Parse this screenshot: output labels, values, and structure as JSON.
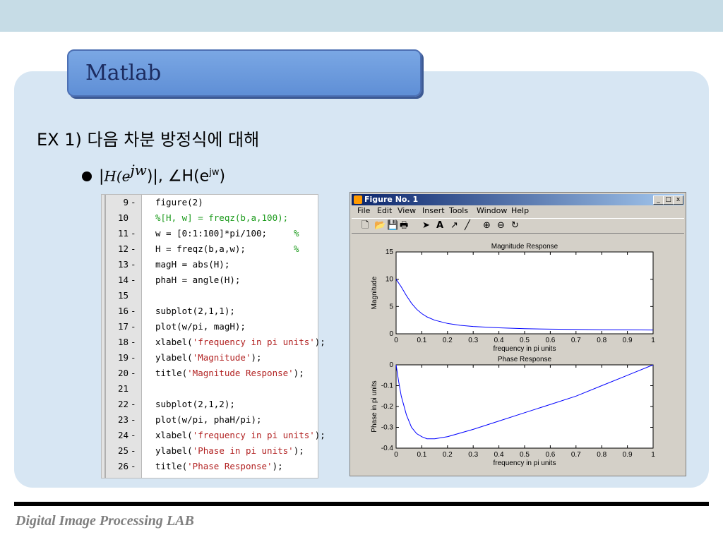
{
  "slide": {
    "tab_title": "Matlab",
    "heading": "EX 1) 다음 차분 방정식에 대해",
    "bullet": {
      "mag_prefix": "|",
      "mag_H": "H(e",
      "mag_sup": "jw",
      "mag_suffix": ")|, ∠H(e",
      "phase_sup": "jw",
      "phase_close": ")"
    },
    "footer": "Digital Image Processing LAB"
  },
  "editor": {
    "lines": [
      {
        "num": "9",
        "dash": "-",
        "code": "figure(2)"
      },
      {
        "num": "10",
        "dash": "",
        "code": "%[H, w] = freqz(b,a,100);"
      },
      {
        "num": "11",
        "dash": "-",
        "code": "w = [0:1:100]*pi/100;",
        "mark": "%"
      },
      {
        "num": "12",
        "dash": "-",
        "code": "H = freqz(b,a,w);",
        "mark": "%"
      },
      {
        "num": "13",
        "dash": "-",
        "code": "magH = abs(H);"
      },
      {
        "num": "14",
        "dash": "-",
        "code": "phaH = angle(H);"
      },
      {
        "num": "15",
        "dash": "",
        "code": ""
      },
      {
        "num": "16",
        "dash": "-",
        "code": "subplot(2,1,1);"
      },
      {
        "num": "17",
        "dash": "-",
        "code": "plot(w/pi, magH);"
      },
      {
        "num": "18",
        "dash": "-",
        "code_pre": "xlabel(",
        "code_str": "'frequency in pi units'",
        "code_post": ");"
      },
      {
        "num": "19",
        "dash": "-",
        "code_pre": "ylabel(",
        "code_str": "'Magnitude'",
        "code_post": ");"
      },
      {
        "num": "20",
        "dash": "-",
        "code_pre": "title(",
        "code_str": "'Magnitude Response'",
        "code_post": ");"
      },
      {
        "num": "21",
        "dash": "",
        "code": ""
      },
      {
        "num": "22",
        "dash": "-",
        "code": "subplot(2,1,2);"
      },
      {
        "num": "23",
        "dash": "-",
        "code": "plot(w/pi, phaH/pi);"
      },
      {
        "num": "24",
        "dash": "-",
        "code_pre": "xlabel(",
        "code_str": "'frequency in pi units'",
        "code_post": ");"
      },
      {
        "num": "25",
        "dash": "-",
        "code_pre": "ylabel(",
        "code_str": "'Phase in pi units'",
        "code_post": ");"
      },
      {
        "num": "26",
        "dash": "-",
        "code_pre": "title(",
        "code_str": "'Phase Response'",
        "code_post": ");"
      }
    ]
  },
  "figure_window": {
    "title": "Figure No. 1",
    "buttons": [
      "_",
      "□",
      "x"
    ],
    "menus": [
      "File",
      "Edit",
      "View",
      "Insert",
      "Tools",
      "Window",
      "Help"
    ],
    "tools": [
      "new-file-icon",
      "open-folder-icon",
      "save-icon",
      "print-icon",
      "pointer-icon",
      "text-tool-icon",
      "arrow-tool-icon",
      "line-tool-icon",
      "zoom-in-icon",
      "zoom-out-icon",
      "rotate-icon"
    ]
  },
  "chart_data": [
    {
      "type": "line",
      "title": "Magnitude Response",
      "xlabel": "frequency in pi units",
      "ylabel": "Magnitude",
      "xlim": [
        0,
        1
      ],
      "ylim": [
        0,
        15
      ],
      "xticks": [
        0,
        0.1,
        0.2,
        0.3,
        0.4,
        0.5,
        0.6,
        0.7,
        0.8,
        0.9,
        1
      ],
      "yticks": [
        0,
        5,
        10,
        15
      ],
      "color": "#0000ff",
      "x": [
        0,
        0.02,
        0.04,
        0.06,
        0.08,
        0.1,
        0.12,
        0.15,
        0.2,
        0.25,
        0.3,
        0.4,
        0.5,
        0.6,
        0.7,
        0.8,
        0.9,
        1.0
      ],
      "y": [
        10.0,
        8.6,
        7.0,
        5.6,
        4.5,
        3.7,
        3.1,
        2.5,
        1.9,
        1.55,
        1.35,
        1.1,
        0.95,
        0.85,
        0.8,
        0.75,
        0.72,
        0.7
      ]
    },
    {
      "type": "line",
      "title": "Phase Response",
      "xlabel": "frequency in pi units",
      "ylabel": "Phase in pi units",
      "xlim": [
        0,
        1
      ],
      "ylim": [
        -0.4,
        0
      ],
      "xticks": [
        0,
        0.1,
        0.2,
        0.3,
        0.4,
        0.5,
        0.6,
        0.7,
        0.8,
        0.9,
        1
      ],
      "yticks": [
        0,
        -0.1,
        -0.2,
        -0.3,
        -0.4
      ],
      "color": "#0000ff",
      "x": [
        0,
        0.01,
        0.02,
        0.04,
        0.06,
        0.08,
        0.1,
        0.12,
        0.15,
        0.2,
        0.3,
        0.4,
        0.5,
        0.6,
        0.7,
        0.8,
        0.9,
        1.0
      ],
      "y": [
        0,
        -0.08,
        -0.15,
        -0.24,
        -0.3,
        -0.33,
        -0.345,
        -0.355,
        -0.355,
        -0.345,
        -0.31,
        -0.27,
        -0.23,
        -0.19,
        -0.15,
        -0.1,
        -0.05,
        0
      ]
    }
  ]
}
